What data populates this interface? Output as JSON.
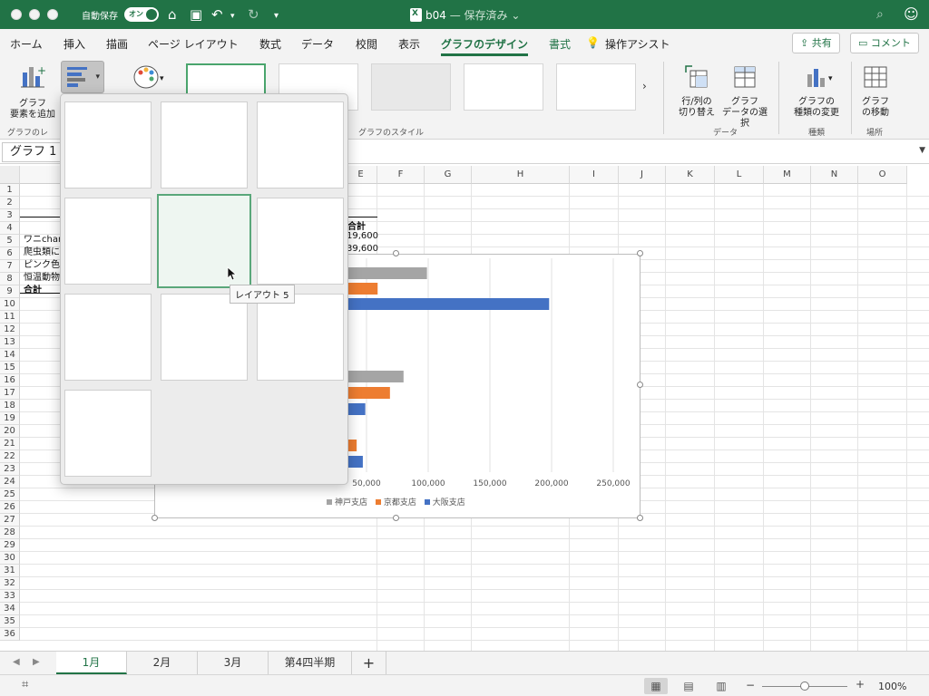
{
  "titlebar": {
    "autosave": "自動保存",
    "toggle": "オン",
    "doc_name": "b04",
    "doc_status": "— 保存済み"
  },
  "tabs": [
    "ホーム",
    "挿入",
    "描画",
    "ページ レイアウト",
    "数式",
    "データ",
    "校閲",
    "表示",
    "グラフのデザイン",
    "書式"
  ],
  "assist": "操作アシスト",
  "share": "共有",
  "comment": "コメント",
  "ribbon": {
    "add_element_1": "グラフ",
    "add_element_2": "要素を追加",
    "group_layout": "グラフのレ",
    "group_style": "グラフのスタイル",
    "switch_1": "行/列の",
    "switch_2": "切り替え",
    "select_1": "グラフ",
    "select_2": "データの選択",
    "group_data": "データ",
    "change_1": "グラフの",
    "change_2": "種類の変更",
    "group_type": "種類",
    "move_1": "グラフ",
    "move_2": "の移動",
    "group_location": "場所"
  },
  "namebox": "グラフ 1",
  "columns": [
    "E",
    "F",
    "G",
    "H",
    "I",
    "J",
    "K",
    "L",
    "M",
    "N",
    "O"
  ],
  "rows": [
    "1",
    "2",
    "3",
    "4",
    "5",
    "6",
    "7",
    "8",
    "9",
    "10",
    "11",
    "12",
    "13",
    "14",
    "15",
    "16",
    "17",
    "18",
    "19",
    "20",
    "21",
    "22",
    "23",
    "24",
    "25",
    "26",
    "27",
    "28",
    "29",
    "30",
    "31",
    "32",
    "33",
    "34",
    "35",
    "36"
  ],
  "cells": {
    "a4": "ワニchan",
    "a5": "爬虫類に",
    "a6": "ピンク色",
    "a7": "恒温動物",
    "a8": "合計",
    "e3": "合計",
    "e4": "19,600",
    "e5": "39,600"
  },
  "tooltip": "レイアウト 5",
  "chart_data": {
    "type": "bar",
    "x_ticks": [
      "50,000",
      "100,000",
      "150,000",
      "200,000",
      "250,000"
    ],
    "xlim": [
      0,
      250000
    ],
    "series": [
      {
        "name": "神戸支店",
        "color": "#a5a5a5"
      },
      {
        "name": "京都支店",
        "color": "#ed7d31"
      },
      {
        "name": "大阪支店",
        "color": "#4472c4"
      }
    ],
    "visible_bars": [
      {
        "series": 0,
        "value": 99000
      },
      {
        "series": 1,
        "value": 59000
      },
      {
        "series": 2,
        "value": 198000
      },
      {
        "series": 0,
        "value": 80000
      },
      {
        "series": 1,
        "value": 69000
      },
      {
        "series": 2,
        "value": 49000
      },
      {
        "series": 1,
        "value": 42000
      },
      {
        "series": 2,
        "value": 47000
      }
    ]
  },
  "sheets": [
    "1月",
    "2月",
    "3月",
    "第4四半期"
  ],
  "zoom": "100%"
}
